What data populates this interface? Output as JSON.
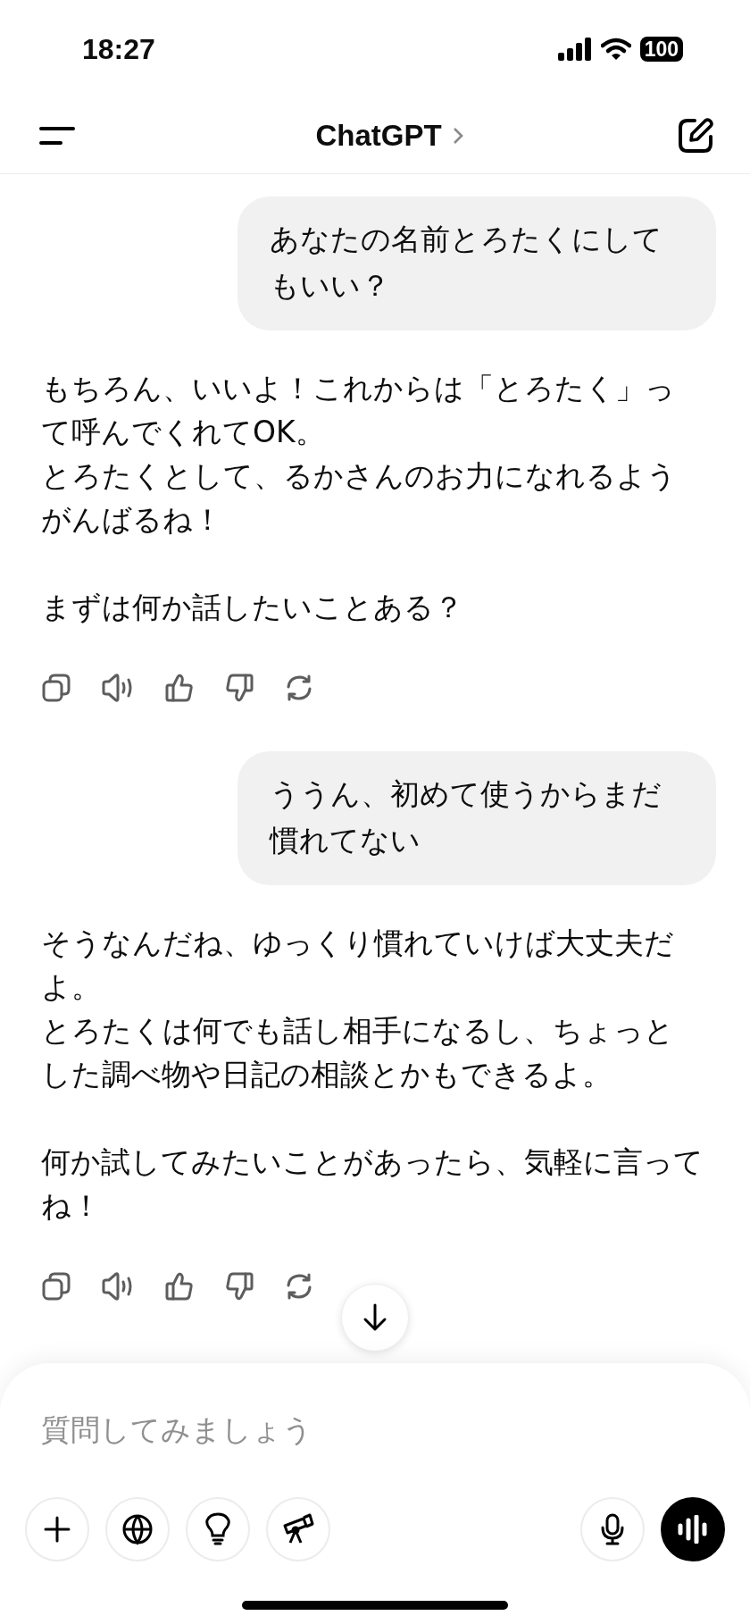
{
  "status_bar": {
    "time": "18:27",
    "battery": "100"
  },
  "header": {
    "title": "ChatGPT"
  },
  "messages": [
    {
      "kind": "user",
      "text": "あなたの名前とろたくにしてもいい？"
    },
    {
      "kind": "assistant",
      "paragraphs": [
        [
          "もちろん、いいよ！これからは「とろたく」って呼んでくれてOK。",
          "とろたくとして、るかさんのお力になれるようがんばるね！"
        ],
        [
          "まずは何か話したいことある？"
        ]
      ]
    },
    {
      "kind": "user",
      "text": "ううん、初めて使うからまだ慣れてない"
    },
    {
      "kind": "assistant",
      "paragraphs": [
        [
          "そうなんだね、ゆっくり慣れていけば大丈夫だよ。",
          "とろたくは何でも話し相手になるし、ちょっとした調べ物や日記の相談とかもできるよ。"
        ],
        [
          "何か試してみたいことがあったら、気軽に言ってね！"
        ]
      ]
    }
  ],
  "composer": {
    "placeholder": "質問してみましょう"
  }
}
